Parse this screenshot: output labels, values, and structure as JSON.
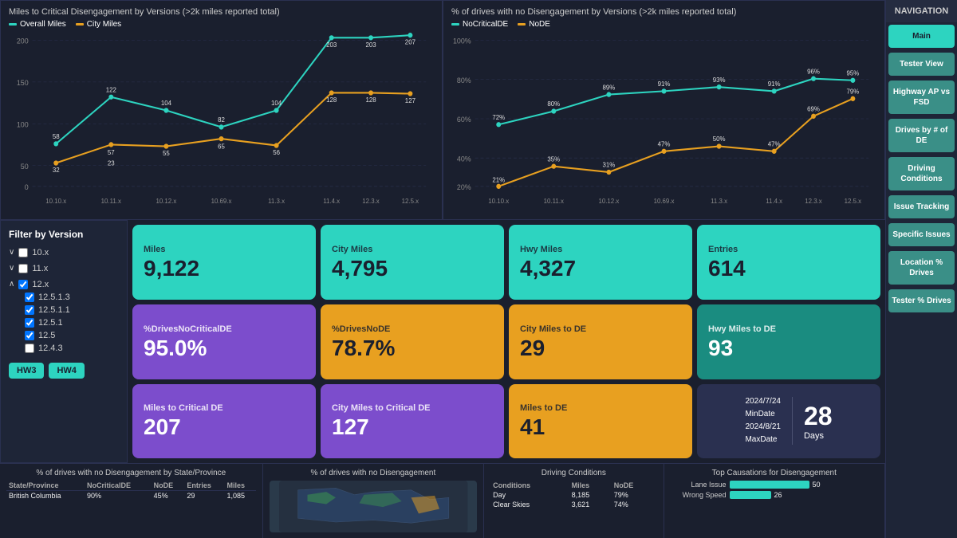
{
  "charts": {
    "left": {
      "title": "Miles to Critical Disengagement by Versions (>2k miles reported total)",
      "legend": [
        "Overall Miles",
        "City Miles"
      ],
      "legend_colors": [
        "#2dd4c0",
        "#e8a020"
      ],
      "x_labels": [
        "10.10.x",
        "10.11.x",
        "10.12.x",
        "10.69.x",
        "11.3.x",
        "11.4.x",
        "12.3.x",
        "12.5.x"
      ],
      "overall": [
        58,
        122,
        104,
        82,
        104,
        203,
        203,
        207
      ],
      "city": [
        32,
        57,
        55,
        65,
        56,
        128,
        128,
        127
      ],
      "y_labels": [
        "0",
        "50",
        "100",
        "150",
        "200"
      ]
    },
    "right": {
      "title": "% of drives with no Disengagement by Versions (>2k miles reported total)",
      "legend": [
        "NoCriticalDE",
        "NoDE"
      ],
      "legend_colors": [
        "#2dd4c0",
        "#e8a020"
      ],
      "x_labels": [
        "10.10.x",
        "10.11.x",
        "10.12.x",
        "10.69.x",
        "11.3.x",
        "11.4.x",
        "12.3.x",
        "12.5.x"
      ],
      "no_critical": [
        72,
        80,
        89,
        91,
        93,
        91,
        96,
        95
      ],
      "no_de": [
        21,
        35,
        31,
        47,
        50,
        47,
        69,
        79
      ],
      "y_labels": [
        "20%",
        "40%",
        "60%",
        "80%",
        "100%"
      ]
    }
  },
  "filter": {
    "title": "Filter by Version",
    "items": [
      {
        "label": "10.x",
        "checked": false,
        "expanded": false
      },
      {
        "label": "11.x",
        "checked": false,
        "expanded": false
      },
      {
        "label": "12.x",
        "checked": true,
        "expanded": true,
        "children": [
          {
            "label": "12.5.1.3",
            "checked": true
          },
          {
            "label": "12.5.1.1",
            "checked": true
          },
          {
            "label": "12.5.1",
            "checked": true
          },
          {
            "label": "12.5",
            "checked": true
          },
          {
            "label": "12.4.3",
            "checked": false
          }
        ]
      }
    ],
    "hw_buttons": [
      "HW3",
      "HW4"
    ]
  },
  "stat_cards": [
    {
      "label": "Miles",
      "value": "9,122",
      "style": "teal"
    },
    {
      "label": "City Miles",
      "value": "4,795",
      "style": "teal"
    },
    {
      "label": "Hwy Miles",
      "value": "4,327",
      "style": "teal"
    },
    {
      "label": "Entries",
      "value": "614",
      "style": "teal"
    },
    {
      "label": "%DrivesNoCriticalDE",
      "value": "95.0%",
      "style": "purple"
    },
    {
      "label": "%DrivesNoDE",
      "value": "78.7%",
      "style": "gold"
    },
    {
      "label": "City Miles to DE",
      "value": "29",
      "style": "gold"
    },
    {
      "label": "Hwy Miles to DE",
      "value": "93",
      "style": "dark-teal"
    },
    {
      "label": "Miles to Critical DE",
      "value": "207",
      "style": "purple"
    },
    {
      "label": "City Miles to Critical DE",
      "value": "127",
      "style": "purple"
    },
    {
      "label": "Miles to DE",
      "value": "41",
      "style": "gold"
    },
    {
      "label": "date",
      "style": "date-card",
      "min_date_label": "2024/7/24",
      "min_date_sub": "MinDate",
      "max_date_label": "2024/8/21",
      "max_date_sub": "MaxDate",
      "days": "28",
      "days_label": "Days"
    }
  ],
  "bottom": {
    "state_table": {
      "title": "% of drives with no Disengagement by State/Province",
      "headers": [
        "State/Province",
        "NoCriticalDE",
        "NoDE",
        "Entries",
        "Miles"
      ],
      "rows": [
        {
          "state": "British Columbia",
          "no_critical": "90%",
          "no_de": "45%",
          "entries": "29",
          "miles": "1,085"
        }
      ]
    },
    "map": {
      "title": "% of drives with no Disengagement"
    },
    "conditions": {
      "title": "Driving Conditions",
      "headers": [
        "Conditions",
        "Miles",
        "NoDE"
      ],
      "rows": [
        {
          "condition": "Day",
          "miles": "8,185",
          "no_de": "79%"
        },
        {
          "condition": "Clear Skies",
          "miles": "3,621",
          "no_de": "74%"
        }
      ]
    },
    "causations": {
      "title": "Top Causations for Disengagement",
      "items": [
        {
          "label": "Lane Issue",
          "value": 50,
          "max": 60
        },
        {
          "label": "Wrong Speed",
          "value": 26,
          "max": 60
        }
      ]
    }
  },
  "navigation": {
    "title": "NAVIGATION",
    "buttons": [
      {
        "label": "Main",
        "active": true
      },
      {
        "label": "Tester View",
        "active": false
      },
      {
        "label": "Highway AP vs FSD",
        "active": false
      },
      {
        "label": "Drives by # of DE",
        "active": false
      },
      {
        "label": "Driving Conditions",
        "active": false
      },
      {
        "label": "Issue Tracking",
        "active": false
      },
      {
        "label": "Specific Issues",
        "active": false
      },
      {
        "label": "Location % Drives",
        "active": false
      },
      {
        "label": "Tester % Drives",
        "active": false
      }
    ]
  }
}
